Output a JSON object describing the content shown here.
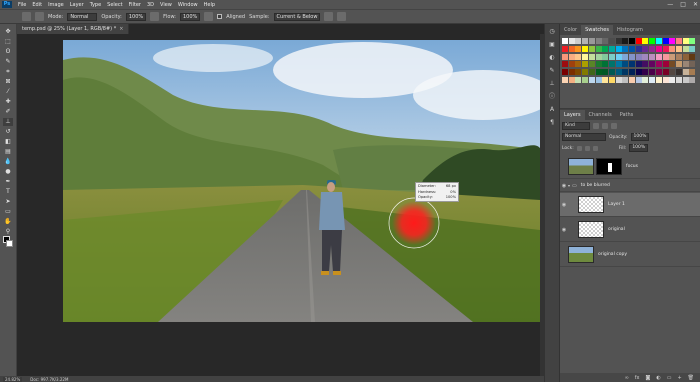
{
  "menubar": {
    "logo": "Ps",
    "items": [
      "File",
      "Edit",
      "Image",
      "Layer",
      "Type",
      "Select",
      "Filter",
      "3D",
      "View",
      "Window",
      "Help"
    ],
    "window_controls": [
      "—",
      "□",
      "✕"
    ]
  },
  "options": {
    "mode_label": "Mode:",
    "mode_value": "Normal",
    "opacity_label": "Opacity:",
    "opacity_value": "100%",
    "flow_label": "Flow:",
    "flow_value": "100%",
    "aligned_label": "Aligned",
    "sample_label": "Sample:",
    "sample_value": "Current & Below"
  },
  "document": {
    "tab_title": "temp.psd @ 25% (Layer 1, RGB/8#) *",
    "tooltip": {
      "diameter_label": "Diameter:",
      "diameter_value": "68 px",
      "hardness_label": "Hardness:",
      "hardness_value": "0%",
      "opacity_label": "Opacity:",
      "opacity_value": "100%"
    },
    "status": {
      "zoom": "24.82%",
      "doc_info": "Doc: 997.7K/3.22M"
    }
  },
  "panels": {
    "top_tabs": [
      "Color",
      "Swatches",
      "Histogram"
    ],
    "top_active": "Swatches",
    "layers_tabs": [
      "Layers",
      "Channels",
      "Paths"
    ],
    "layers_active": "Layers",
    "kind_label": "Kind",
    "blend_mode": "Normal",
    "opacity_label": "Opacity:",
    "opacity_value": "100%",
    "lock_label": "Lock:",
    "fill_label": "Fill:",
    "fill_value": "100%",
    "layers": [
      {
        "name": "focus"
      },
      {
        "name": "to be blurred"
      },
      {
        "name": "Layer 1"
      },
      {
        "name": "original"
      },
      {
        "name": "original copy"
      }
    ]
  },
  "colors": {
    "chrome": "#535353",
    "dark": "#282828",
    "selected_layer": "#6b6b6b",
    "brush": "#ff1a1a"
  },
  "swatches": [
    "#ffffff",
    "#e6e6e6",
    "#cccccc",
    "#b3b3b3",
    "#999999",
    "#808080",
    "#666666",
    "#4d4d4d",
    "#333333",
    "#1a1a1a",
    "#000000",
    "#ff0000",
    "#ffff00",
    "#00ff00",
    "#00ffff",
    "#0000ff",
    "#ff00ff",
    "#ff8080",
    "#ffff80",
    "#80ff80",
    "#ed1c24",
    "#f26522",
    "#f7941d",
    "#fff200",
    "#8dc63f",
    "#39b54a",
    "#00a651",
    "#00a99d",
    "#00aeef",
    "#0072bc",
    "#0054a6",
    "#2e3192",
    "#662d91",
    "#92278f",
    "#ec008c",
    "#ed145b",
    "#f69679",
    "#fdc689",
    "#c4df9b",
    "#7accc8",
    "#f7977a",
    "#f9ad81",
    "#fdc68a",
    "#fff79a",
    "#c4df9b",
    "#a3d39c",
    "#82ca9c",
    "#7bcdc8",
    "#6ecff6",
    "#7ea7d8",
    "#8393ca",
    "#8882be",
    "#a187be",
    "#bc8dbf",
    "#f49ac2",
    "#f6989d",
    "#ca9c78",
    "#a9805f",
    "#8c6239",
    "#603913",
    "#9e0b0f",
    "#a0410d",
    "#a3620a",
    "#aba000",
    "#598527",
    "#1a7b30",
    "#007236",
    "#00746b",
    "#0076a3",
    "#004b80",
    "#003471",
    "#1b1464",
    "#440e62",
    "#630460",
    "#9e005d",
    "#9e0039",
    "#754c24",
    "#c69c6d",
    "#998675",
    "#736357",
    "#790000",
    "#7b2e00",
    "#7d4900",
    "#827b00",
    "#406618",
    "#005e20",
    "#005826",
    "#005952",
    "#005b7f",
    "#003663",
    "#002157",
    "#0d004c",
    "#32004b",
    "#4b0049",
    "#7b0046",
    "#7a0026",
    "#534741",
    "#362f2d",
    "#c7b299",
    "#a67c52",
    "#fbd4b4",
    "#f4b083",
    "#c5e0b3",
    "#a8d08d",
    "#bdd7ee",
    "#9cc3e5",
    "#ffe599",
    "#ffd966",
    "#d9d9d9",
    "#bfbfbf",
    "#f8cbad",
    "#b4c7e7",
    "#e2efd9",
    "#deebf6",
    "#fff2cc",
    "#fce4d6",
    "#ededed",
    "#dbdbdb",
    "#c9c9c9",
    "#aeaaaa"
  ]
}
